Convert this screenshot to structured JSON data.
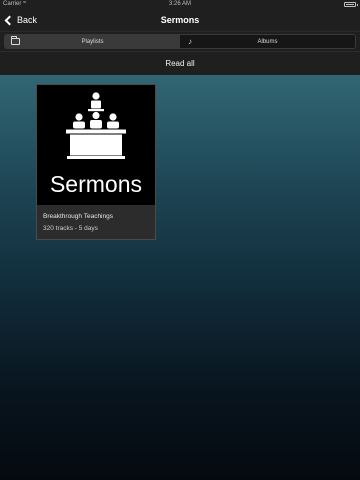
{
  "status_bar": {
    "carrier": "Carrier",
    "wifi_icon": "wifi-icon",
    "time": "3:26 AM",
    "battery_icon": "battery-icon"
  },
  "nav": {
    "back_label": "Back",
    "title": "Sermons"
  },
  "segments": [
    {
      "label": "Playlists",
      "icon": "folder-icon",
      "active": false
    },
    {
      "label": "Albums",
      "icon": "music-note-icon",
      "active": true
    }
  ],
  "read_all_label": "Read all",
  "playlists": [
    {
      "cover_text": "Sermons",
      "cover_icon": "preacher-podium-icon",
      "title": "Breakthrough Teachings",
      "subtitle": "320 tracks - 5 days"
    }
  ],
  "colors": {
    "bar_background": "#1f1f1f",
    "gradient_top": "#3f7c86",
    "gradient_bottom": "#040a10"
  }
}
